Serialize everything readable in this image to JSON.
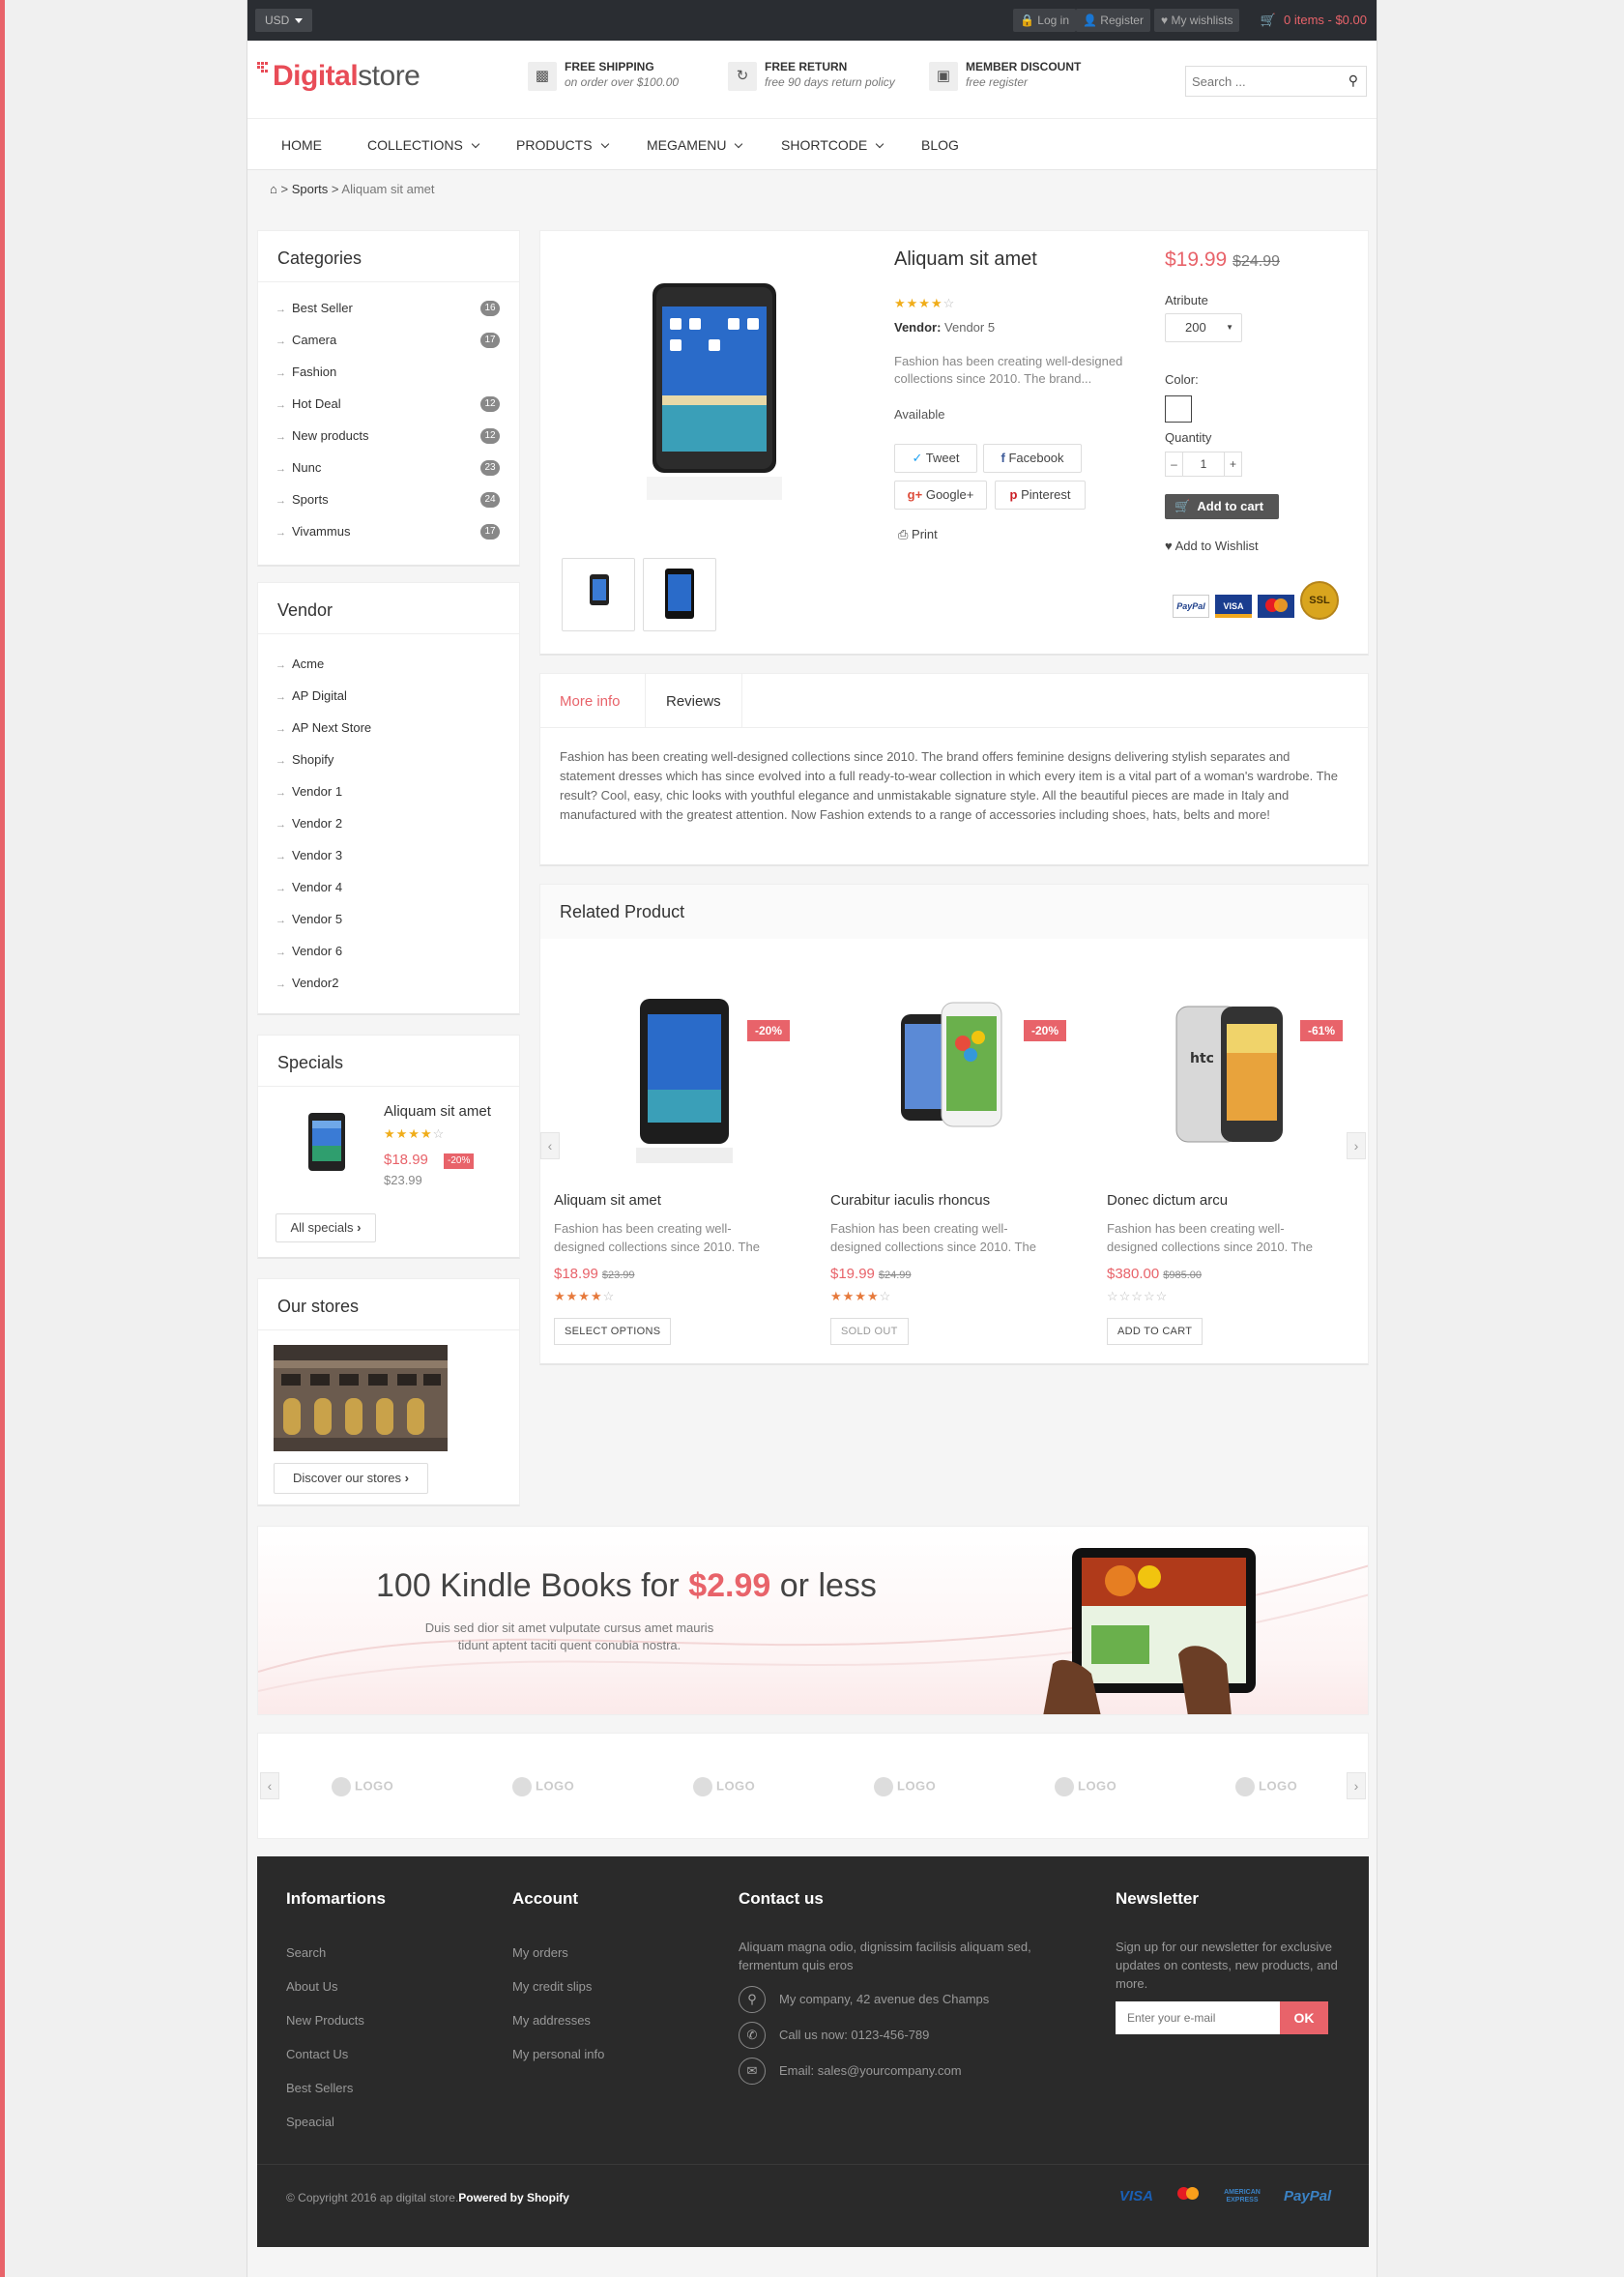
{
  "topbar": {
    "currency": "USD",
    "login": "Log in",
    "register": "Register",
    "wishlists": "My wishlists",
    "cart": "0 items - $0.00"
  },
  "header": {
    "logo_strong": "Digital",
    "logo_rest": "store",
    "features": [
      {
        "icon": "truck-icon",
        "title": "FREE SHIPPING",
        "subtitle": "on order over $100.00"
      },
      {
        "icon": "refresh-icon",
        "title": "FREE RETURN",
        "subtitle": "free 90 days return policy"
      },
      {
        "icon": "money-icon",
        "title": "MEMBER DISCOUNT",
        "subtitle": "free register"
      }
    ],
    "search_placeholder": "Search ..."
  },
  "nav": {
    "items": [
      "HOME",
      "COLLECTIONS",
      "PRODUCTS",
      "MEGAMENU",
      "SHORTCODE",
      "BLOG"
    ]
  },
  "breadcrumb": {
    "sep": ">",
    "section": "Sports",
    "current": "Aliquam sit amet"
  },
  "sidebar": {
    "categories_title": "Categories",
    "categories": [
      {
        "label": "Best Seller",
        "count": "16"
      },
      {
        "label": "Camera",
        "count": "17"
      },
      {
        "label": "Fashion",
        "count": ""
      },
      {
        "label": "Hot Deal",
        "count": "12"
      },
      {
        "label": "New products",
        "count": "12"
      },
      {
        "label": "Nunc",
        "count": "23"
      },
      {
        "label": "Sports",
        "count": "24"
      },
      {
        "label": "Vivammus",
        "count": "17"
      }
    ],
    "vendor_title": "Vendor",
    "vendors": [
      "Acme",
      "AP Digital",
      "AP Next Store",
      "Shopify",
      "Vendor 1",
      "Vendor 2",
      "Vendor 3",
      "Vendor 4",
      "Vendor 5",
      "Vendor 6",
      "Vendor2"
    ],
    "specials_title": "Specials",
    "special": {
      "name": "Aliquam sit amet",
      "rating": 4,
      "price": "$18.99",
      "discount": "-20%",
      "old_price": "$23.99"
    },
    "all_specials": "All specials",
    "stores_title": "Our stores",
    "discover": "Discover our stores"
  },
  "product": {
    "title": "Aliquam sit amet",
    "rating": 4,
    "vendor_label": "Vendor:",
    "vendor": "Vendor 5",
    "short_desc": "Fashion has been creating well-designed collections since 2010. The brand...",
    "availability": "Available",
    "share": {
      "tweet": "Tweet",
      "facebook": "Facebook",
      "google": "Google+",
      "pinterest": "Pinterest",
      "print": "Print"
    },
    "price": "$19.99",
    "old_price": "$24.99",
    "attribute_label": "Atribute",
    "attribute_value": "200",
    "color_label": "Color:",
    "quantity_label": "Quantity",
    "quantity": "1",
    "add_to_cart": "Add to cart",
    "add_to_wishlist": "Add to Wishlist",
    "payments": [
      "PayPal",
      "VISA",
      "MasterCard",
      "SSL"
    ]
  },
  "tabs": {
    "more_info": "More info",
    "reviews": "Reviews",
    "description": "Fashion has been creating well-designed collections since 2010. The brand offers feminine designs delivering stylish separates and statement dresses which has since evolved into a full ready-to-wear collection in which every item is a vital part of a woman's wardrobe. The result? Cool, easy, chic looks with youthful elegance and unmistakable signature style. All the beautiful pieces are made in Italy and manufactured with the greatest attention. Now Fashion extends to a range of accessories including shoes, hats, belts and more!"
  },
  "related": {
    "title": "Related Product",
    "items": [
      {
        "name": "Aliquam sit amet",
        "desc": "Fashion has been creating well-designed collections since 2010. The",
        "price": "$18.99",
        "old_price": "$23.99",
        "discount": "-20%",
        "rating": 4,
        "button": "SELECT OPTIONS"
      },
      {
        "name": "Curabitur iaculis rhoncus",
        "desc": "Fashion has been creating well-designed collections since 2010. The",
        "price": "$19.99",
        "old_price": "$24.99",
        "discount": "-20%",
        "rating": 4,
        "button": "SOLD OUT"
      },
      {
        "name": "Donec dictum arcu",
        "desc": "Fashion has been creating well-designed collections since 2010. The",
        "price": "$380.00",
        "old_price": "$985.00",
        "discount": "-61%",
        "rating": 0,
        "button": "ADD TO CART"
      }
    ]
  },
  "banner": {
    "headline_a": "100 Kindle Books for",
    "headline_price": "$2.99",
    "headline_b": "or less",
    "sub": "Duis sed dior sit amet vulputate cursus amet mauris tidunt aptent taciti quent conubia nostra."
  },
  "brands": [
    "LOGO",
    "LOGO",
    "LOGO",
    "LOGO",
    "LOGO",
    "LOGO"
  ],
  "footer": {
    "info_title": "Infomartions",
    "info_links": [
      "Search",
      "About Us",
      "New Products",
      "Contact Us",
      "Best Sellers",
      "Speacial"
    ],
    "account_title": "Account",
    "account_links": [
      "My orders",
      "My credit slips",
      "My addresses",
      "My personal info"
    ],
    "contact_title": "Contact us",
    "contact_text": "Aliquam magna odio, dignissim facilisis aliquam sed, fermentum quis eros",
    "address": "My company, 42 avenue des Champs",
    "phone": "Call us now: 0123-456-789",
    "email": "Email: sales@yourcompany.com",
    "newsletter_title": "Newsletter",
    "newsletter_text": "Sign up for our newsletter for exclusive updates on contests, new products, and more.",
    "newsletter_placeholder": "Enter your e-mail",
    "newsletter_button": "OK",
    "copyright": "© Copyright 2016 ap digital store.",
    "powered": "Powered by Shopify",
    "payments": [
      "VISA",
      "MasterCard",
      "AMERICAN EXPRESS",
      "PayPal"
    ]
  },
  "colors": {
    "accent": "#e8636a",
    "dark": "#2a2d32",
    "star": "#f0ad1a"
  }
}
